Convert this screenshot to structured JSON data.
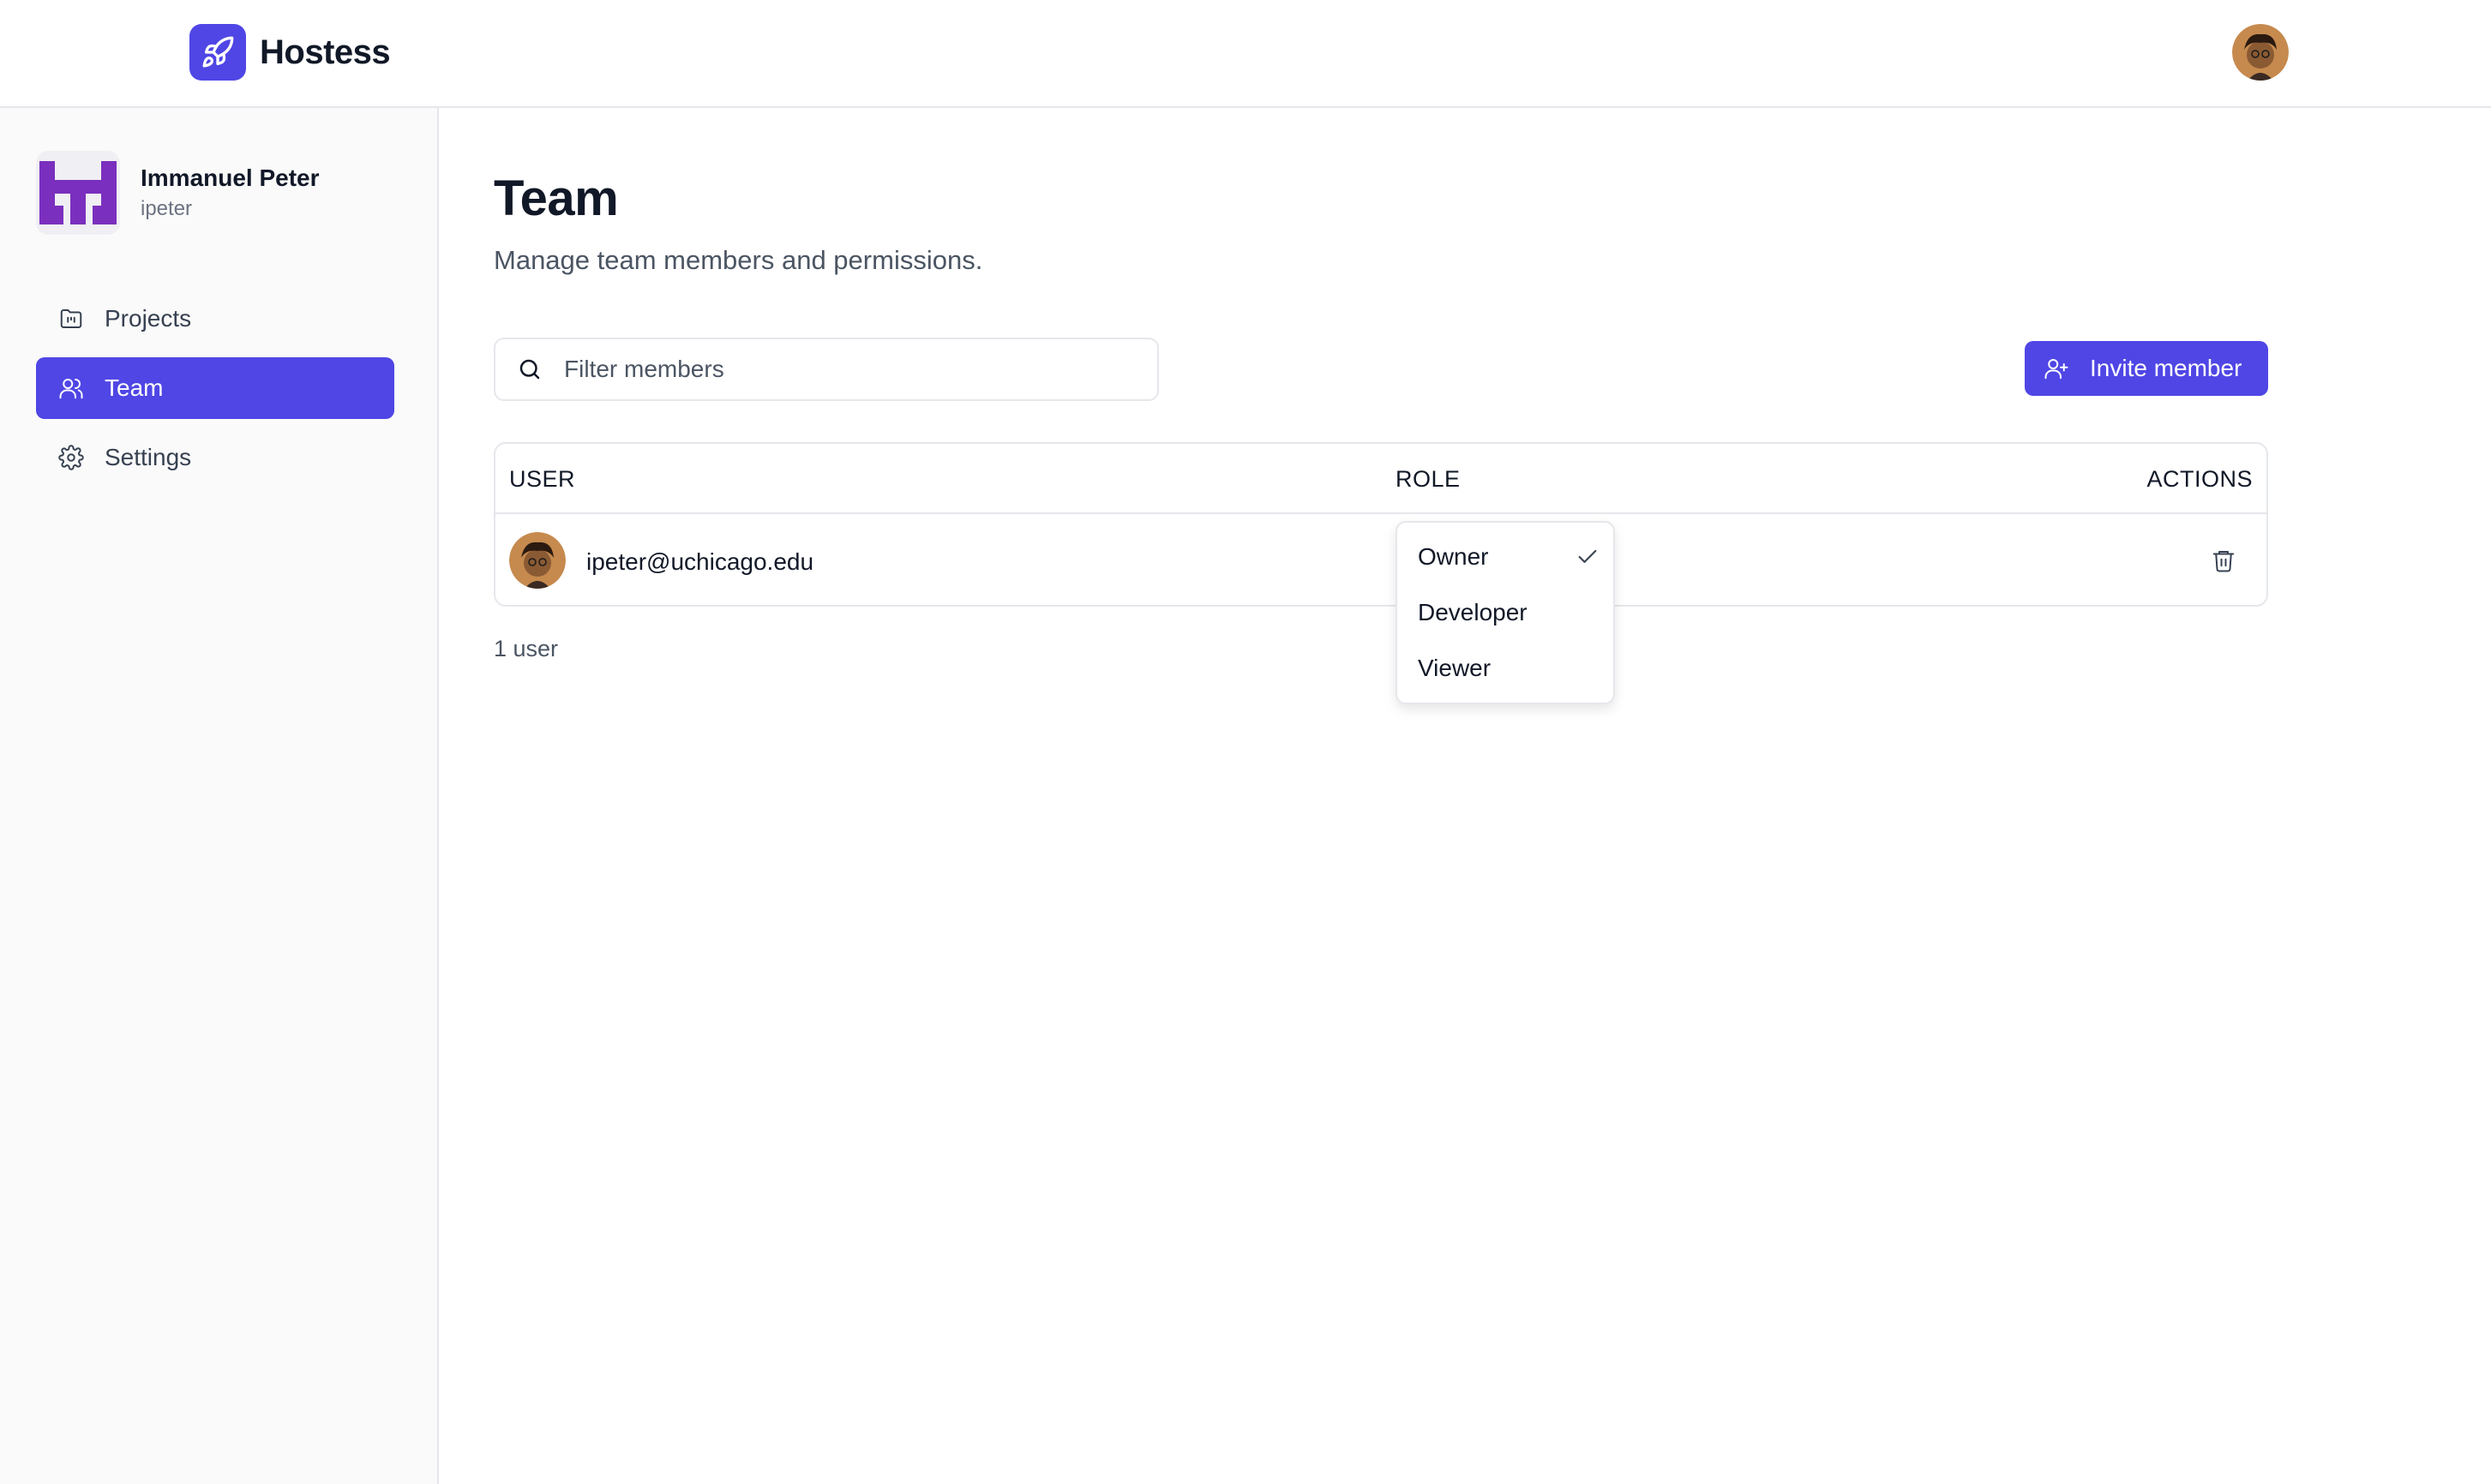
{
  "app": {
    "name": "Hostess",
    "logo_icon": "rocket-icon",
    "accent": "#4f46e5"
  },
  "user": {
    "name": "Immanuel Peter",
    "handle": "ipeter"
  },
  "sidebar": {
    "items": [
      {
        "label": "Projects",
        "icon": "folder-icon",
        "active": false
      },
      {
        "label": "Team",
        "icon": "users-icon",
        "active": true
      },
      {
        "label": "Settings",
        "icon": "gear-icon",
        "active": false
      }
    ]
  },
  "page": {
    "title": "Team",
    "subtitle": "Manage team members and permissions."
  },
  "search": {
    "placeholder": "Filter members",
    "value": ""
  },
  "invite_button": {
    "label": "Invite member",
    "icon": "user-plus-icon"
  },
  "table": {
    "columns": [
      "USER",
      "ROLE",
      "ACTIONS"
    ],
    "rows": [
      {
        "email": "ipeter@uchicago.edu",
        "role": "Owner"
      }
    ]
  },
  "count_label": "1 user",
  "role_dropdown": {
    "options": [
      "Owner",
      "Developer",
      "Viewer"
    ],
    "selected": "Owner"
  }
}
